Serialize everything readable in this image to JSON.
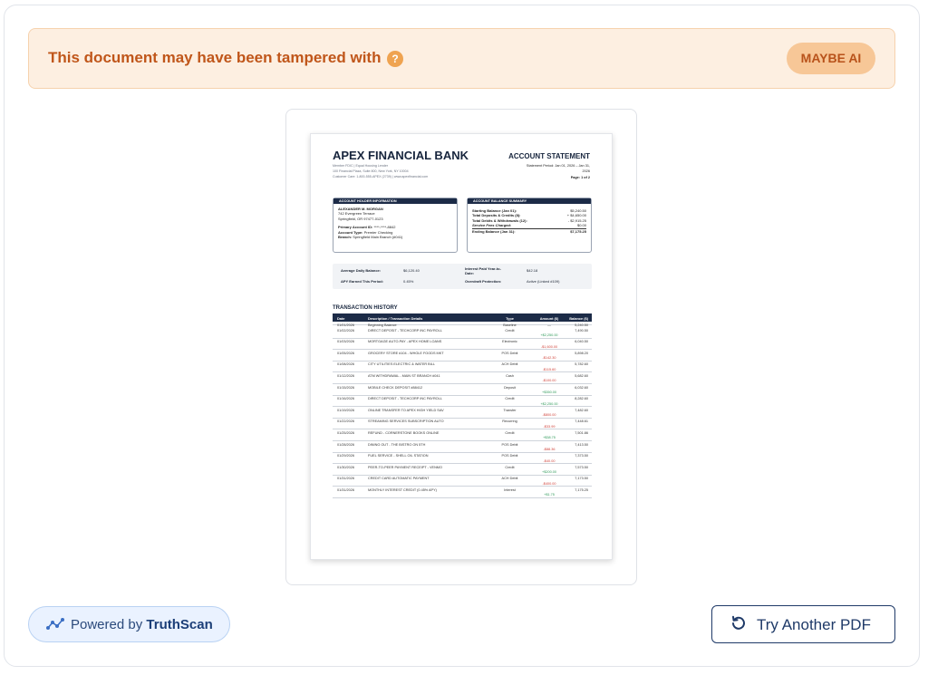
{
  "banner": {
    "message": "This document may have been tampered with",
    "help_glyph": "?",
    "badge": "MAYBE AI",
    "accent": "#c0561a",
    "background": "#fdefe1"
  },
  "document": {
    "bank_name": "APEX FINANCIAL BANK",
    "bank_sub1": "Member FDIC  |  Equal Housing Lender",
    "bank_sub2": "100 Financial Plaza, Suite 800, New York, NY 10004",
    "bank_sub3": "Customer Care: 1-800-555-APEX (2739)  |  www.apexfinancial.com",
    "statement_title": "ACCOUNT STATEMENT",
    "statement_period_line1": "Statement Period: Jan 01, 2026 – Jan 31,",
    "statement_period_line2": "2026",
    "page_label": "Page: 1 of 2",
    "holder_box": {
      "title": "ACCOUNT HOLDER INFORMATION",
      "name": "ALEXANDER M. MORGAN",
      "address1": "742 Evergreen Terrace",
      "address2": "Springfield, OR 97477-0123",
      "account_id_label": "Primary Account ID:",
      "account_id_value": "****-****-8842",
      "account_type_label": "Account Type:",
      "account_type_value": "Premier Checking",
      "branch_label": "Branch:",
      "branch_value": "Springfield Main Branch (#041)"
    },
    "summary_box": {
      "title": "ACCOUNT BALANCE SUMMARY",
      "rows": [
        {
          "label": "Starting Balance (Jan 01):",
          "value": "$5,240.50"
        },
        {
          "label": "Total Deposits & Credits (8):",
          "value": "+ $4,650.00"
        },
        {
          "label": "Total Debits & Withdrawals (12):",
          "value": "- $2,915.25"
        },
        {
          "label": "Service Fees Charged:",
          "value": "$0.00"
        },
        {
          "label": "Ending Balance (Jan 31):",
          "value": "$7,175.25"
        }
      ]
    },
    "info_strip": {
      "avg_label": "Average Daily Balance:",
      "avg_value": "$6,120.40",
      "apy_label": "APY Earned This Period:",
      "apy_value": "0.45%",
      "interest_label_1": "Interest Paid Year-to-",
      "interest_label_2": "Date:",
      "interest_value": "$42.18",
      "overdraft_label": "Overdraft Protection:",
      "overdraft_value": "Active (Linked #109)"
    },
    "transactions": {
      "title": "TRANSACTION HISTORY",
      "headers": [
        "Date",
        "Description / Transaction Details",
        "Type",
        "Amount ($)",
        "Balance ($)"
      ],
      "rows": [
        {
          "date": "01/01/2026",
          "desc": "Beginning Balance",
          "type": "Baseline",
          "amount": "—",
          "balance": "5,240.50",
          "sign": "none"
        },
        {
          "date": "01/02/2026",
          "desc": "DIRECT DEPOSIT - TECHCORP INC PAYROLL",
          "type": "Credit",
          "amount": "+$2,250.00",
          "balance": "7,490.50",
          "sign": "pos"
        },
        {
          "date": "01/03/2026",
          "desc": "MORTGAGE AUTO-PAY - APEX HOME LOANS",
          "type": "Electronic",
          "amount": "-$1,600.00",
          "balance": "6,040.50",
          "sign": "neg"
        },
        {
          "date": "01/05/2026",
          "desc": "GROCERY STORE #104 - WHOLE FOODS MKT",
          "type": "POS Debit",
          "amount": "-$142.30",
          "balance": "5,898.20",
          "sign": "neg"
        },
        {
          "date": "01/08/2026",
          "desc": "CITY UTILITIES ELECTRIC & WATER BILL",
          "type": "ACH Debit",
          "amount": "-$115.60",
          "balance": "5,782.60",
          "sign": "neg"
        },
        {
          "date": "01/12/2026",
          "desc": "ATM WITHDRAWAL - MAIN ST BRANCH #041",
          "type": "Cash",
          "amount": "-$100.00",
          "balance": "5,682.60",
          "sign": "neg"
        },
        {
          "date": "01/15/2026",
          "desc": "MOBILE CHECK DEPOSIT #88412",
          "type": "Deposit",
          "amount": "+$350.00",
          "balance": "6,032.60",
          "sign": "pos"
        },
        {
          "date": "01/16/2026",
          "desc": "DIRECT DEPOSIT - TECHCORP INC PAYROLL",
          "type": "Credit",
          "amount": "+$2,250.00",
          "balance": "8,282.60",
          "sign": "pos"
        },
        {
          "date": "01/19/2026",
          "desc": "ONLINE TRANSFER TO APEX HIGH YIELD SAV",
          "type": "Transfer",
          "amount": "-$800.00",
          "balance": "7,482.60",
          "sign": "neg"
        },
        {
          "date": "01/22/2026",
          "desc": "STREAMING SERVICES SUBSCRIPTION AUTO",
          "type": "Recurring",
          "amount": "-$33.99",
          "balance": "7,448.61",
          "sign": "neg"
        },
        {
          "date": "01/25/2026",
          "desc": "REFUND - CORNERSTONE BOOKS ONLINE",
          "type": "Credit",
          "amount": "+$38.75",
          "balance": "7,501.86",
          "sign": "pos"
        },
        {
          "date": "01/28/2026",
          "desc": "DINING OUT - THE BISTRO ON 5TH",
          "type": "POS Debit",
          "amount": "-$88.36",
          "balance": "7,413.50",
          "sign": "neg"
        },
        {
          "date": "01/29/2026",
          "desc": "FUEL SERVICE - SHELL OIL STATION",
          "type": "POS Debit",
          "amount": "-$40.00",
          "balance": "7,373.50",
          "sign": "neg"
        },
        {
          "date": "01/30/2026",
          "desc": "PEER-TO-PEER PAYMENT RECEIPT - VENMO",
          "type": "Credit",
          "amount": "+$200.00",
          "balance": "7,573.50",
          "sign": "pos"
        },
        {
          "date": "01/31/2026",
          "desc": "CREDIT CARD AUTOMATIC PAYMENT",
          "type": "ACH Debit",
          "amount": "-$400.00",
          "balance": "7,173.50",
          "sign": "neg"
        },
        {
          "date": "01/31/2026",
          "desc": "MONTHLY INTEREST CREDIT (0.45% APY)",
          "type": "Interest",
          "amount": "+$1.75",
          "balance": "7,175.25",
          "sign": "pos"
        }
      ]
    }
  },
  "footer": {
    "powered_prefix": "Powered by",
    "powered_brand": "TruthScan",
    "try_label": "Try Another PDF"
  }
}
